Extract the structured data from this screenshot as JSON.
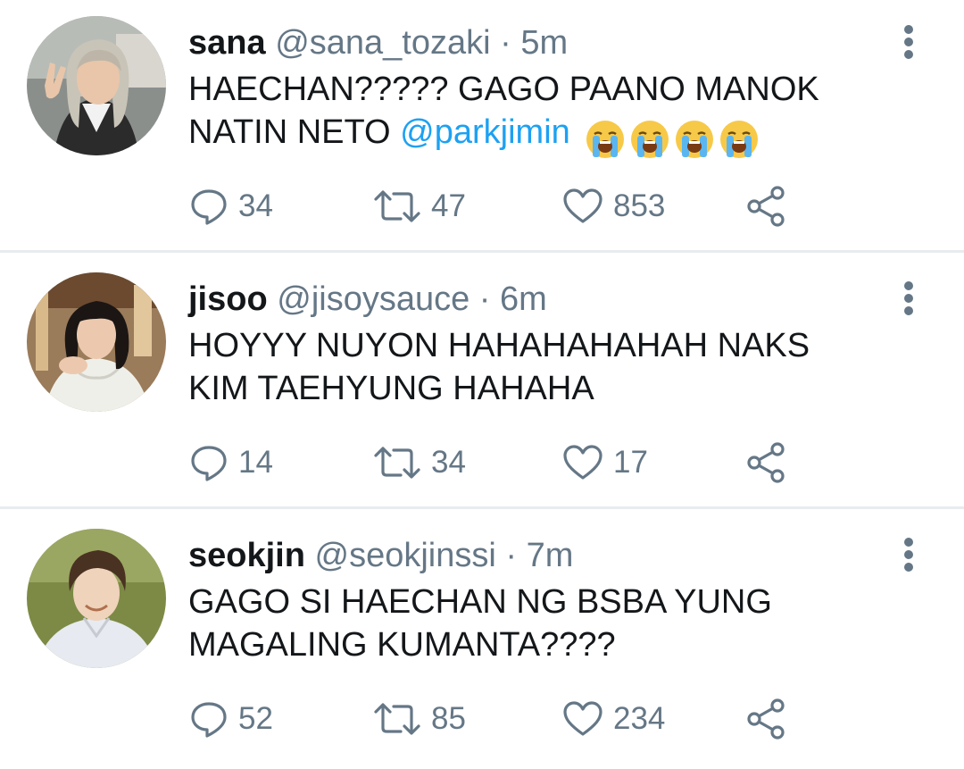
{
  "tweets": [
    {
      "name": "sana",
      "handle": "@sana_tozaki",
      "separator": " · ",
      "time": "5m",
      "text_line1": "HAECHAN????? GAGO PAANO MANOK",
      "text_line2": "NATIN NETO",
      "mention": "@parkjimin",
      "emoji": [
        "loudly-crying-face",
        "loudly-crying-face",
        "loudly-crying-face",
        "loudly-crying-face"
      ],
      "replies": "34",
      "retweets": "47",
      "likes": "853"
    },
    {
      "name": "jisoo",
      "handle": "@jisoysauce",
      "separator": " · ",
      "time": "6m",
      "text_line1": "HOYYY NUYON HAHAHAHAHAH NAKS",
      "text_line2": "KIM TAEHYUNG HAHAHA",
      "replies": "14",
      "retweets": "34",
      "likes": "17"
    },
    {
      "name": "seokjin",
      "handle": "@seokjinssi",
      "separator": " · ",
      "time": "7m",
      "text_line1": "GAGO SI HAECHAN NG BSBA YUNG",
      "text_line2": "MAGALING KUMANTA????",
      "replies": "52",
      "retweets": "85",
      "likes": "234"
    }
  ],
  "icons": {
    "reply": "reply-icon",
    "retweet": "retweet-icon",
    "like": "like-icon",
    "share": "share-icon",
    "more": "more-options-icon"
  },
  "colors": {
    "text": "#14171a",
    "secondary": "#657786",
    "mention": "#1da1f2",
    "divider": "#e8ecef"
  }
}
